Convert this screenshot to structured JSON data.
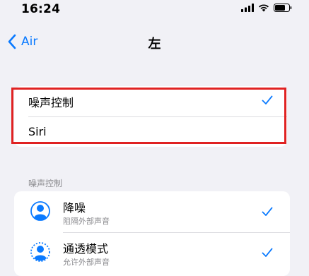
{
  "status_bar": {
    "time": "16:24",
    "icons": [
      "signal-icon",
      "wifi-icon",
      "battery-icon"
    ]
  },
  "nav": {
    "back_label": "Air",
    "title": "左"
  },
  "press_options": {
    "items": [
      {
        "label": "噪声控制",
        "selected": true
      },
      {
        "label": "Siri",
        "selected": false
      }
    ],
    "highlight_color": "#e02222"
  },
  "noise_control": {
    "header": "噪声控制",
    "items": [
      {
        "title": "降噪",
        "subtitle": "阻隔外部声音",
        "checked": true,
        "icon": "noise-cancellation-icon"
      },
      {
        "title": "通透模式",
        "subtitle": "允许外部声音",
        "checked": true,
        "icon": "transparency-icon"
      }
    ]
  },
  "colors": {
    "accent": "#0a7aff",
    "background": "#f1f1f6"
  }
}
